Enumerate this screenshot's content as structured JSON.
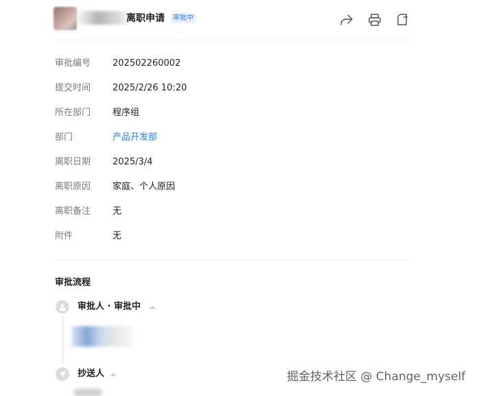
{
  "header": {
    "title": "离职申请",
    "status_badge": "审批中"
  },
  "toolbar": {
    "share_icon": "share-icon",
    "print_icon": "printer-icon",
    "copy_icon": "copy-icon"
  },
  "details": [
    {
      "label": "审批编号",
      "value": "202502260002",
      "is_link": false
    },
    {
      "label": "提交时间",
      "value": "2025/2/26 10:20",
      "is_link": false
    },
    {
      "label": "所在部门",
      "value": "程序组",
      "is_link": false
    },
    {
      "label": "部门",
      "value": "产品开发部",
      "is_link": true
    },
    {
      "label": "离职日期",
      "value": "2025/3/4",
      "is_link": false
    },
    {
      "label": "离职原因",
      "value": "家庭、个人原因",
      "is_link": false
    },
    {
      "label": "离职备注",
      "value": "无",
      "is_link": false
    },
    {
      "label": "附件",
      "value": "无",
      "is_link": false
    }
  ],
  "process": {
    "title": "审批流程",
    "approver_node": {
      "label": "审批人 · 审批中",
      "icon": "user-icon"
    },
    "cc_node": {
      "label": "抄送人",
      "icon": "send-icon"
    }
  },
  "watermark": "掘金技术社区 @ Change_myself",
  "colors": {
    "accent": "#3478f6",
    "link": "#3478c6",
    "badge_bg": "#e8f0fe"
  }
}
